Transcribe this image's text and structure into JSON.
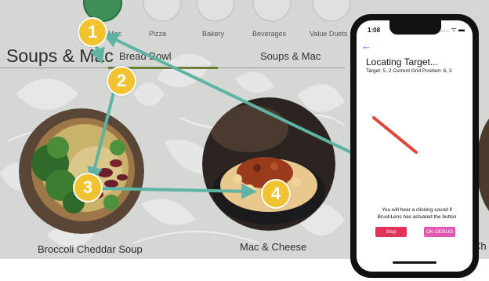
{
  "kiosk": {
    "categories": [
      "Mac",
      "Pizza",
      "Bakery",
      "Beverages",
      "Value Duets"
    ],
    "section_title": "Soups & Mac",
    "tabs": [
      "Bread Bowl",
      "Soups & Mac"
    ],
    "items": [
      "Broccoli Cheddar Soup",
      "Mac & Cheese",
      "Ch"
    ],
    "accent_color": "#6d7f36"
  },
  "markers": [
    "1",
    "2",
    "3",
    "4"
  ],
  "marker_color": "#f2c330",
  "arrow_color": "#5fb3a3",
  "phone": {
    "time": "1:08",
    "status": "..... ᯤ ▬",
    "title": "Locating Target...",
    "subtitle": "Target: 5, 2  Current Grid Position: 6, 3",
    "instruction": "You will hear a clicking sound if BrushLens has actuated the button",
    "stop_label": "Stop",
    "ok_label": "OK-DEBUG",
    "stop_color": "#e1325a",
    "ok_color": "#e157b2"
  }
}
